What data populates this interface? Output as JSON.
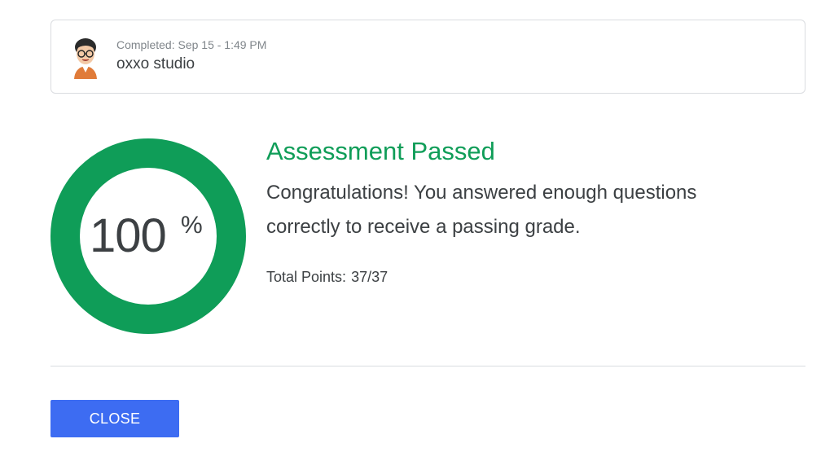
{
  "submission": {
    "completed_text": "Completed: Sep 15 - 1:49 PM",
    "user_name": "oxxo studio",
    "avatar_icon": "user-avatar-icon"
  },
  "result": {
    "percent_value": "100",
    "percent_sign": "%",
    "score_fraction": 1.0,
    "ring_color": "#0f9d58",
    "title": "Assessment Passed",
    "message": "Congratulations! You answered enough questions correctly to receive a passing grade.",
    "points_label": "Total Points:",
    "points_value": "37/37"
  },
  "actions": {
    "close_label": "CLOSE",
    "close_color": "#3d6cf2"
  }
}
